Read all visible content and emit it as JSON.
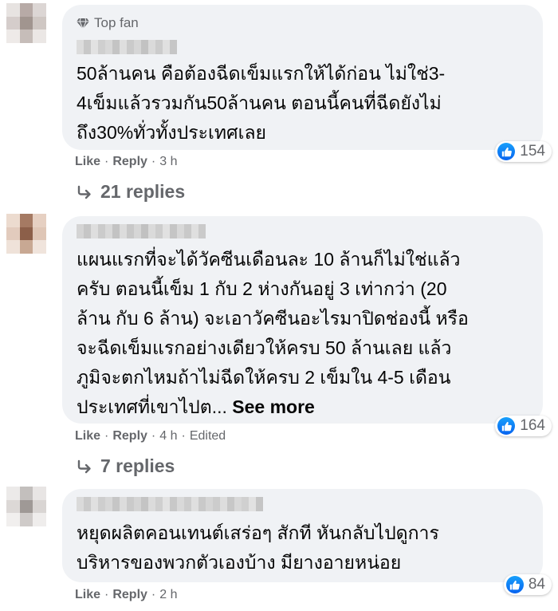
{
  "comments": [
    {
      "badge": "Top fan",
      "text": "50ล้านคน คือต้องฉีดเข็มแรกให้ได้ก่อน ไม่ใช่3-\n4เข็มแล้วรวมกัน50ล้านคน ตอนนี้คนที่ฉีดยังไม่\nถึง30%ทั่วทั้งประเทศเลย",
      "reactions": "154",
      "like": "Like",
      "reply": "Reply",
      "time": "3 h",
      "replies": "21 replies"
    },
    {
      "text": "แผนแรกที่จะได้วัคซีนเดือนละ 10 ล้านก็ไม่ใช่แล้ว\nครับ ตอนนี้เข็ม 1 กับ 2 ห่างกันอยู่ 3 เท่ากว่า (20\nล้าน กับ 6 ล้าน) จะเอาวัคซีนอะไรมาปิดช่องนี้ หรือ\nจะฉีดเข็มแรกอย่างเดียวให้ครบ 50 ล้านเลย แล้ว\nภูมิจะตกไหมถ้าไม่ฉีดให้ครบ 2 เข็มใน 4-5 เดือน\nประเทศที่เขาไปต...",
      "see_more": "See more",
      "reactions": "164",
      "like": "Like",
      "reply": "Reply",
      "time": "4 h",
      "edited": "Edited",
      "replies": "7 replies"
    },
    {
      "text": "หยุดผลิตคอนเทนต์เสร่อๆ สักที หันกลับไปดูการ\nบริหารของพวกตัวเองบ้าง มียางอายหน่อย",
      "reactions": "84",
      "like": "Like",
      "reply": "Reply",
      "time": "2 h"
    }
  ],
  "colors": {
    "bubble": "#f0f2f5",
    "secondary_text": "#65676b",
    "like_blue": "#1877f2"
  },
  "icons": [
    "diamond-icon",
    "like-thumb-icon",
    "reply-arrow-icon"
  ]
}
